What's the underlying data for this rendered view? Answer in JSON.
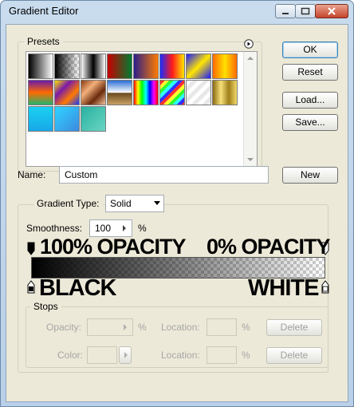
{
  "window": {
    "title": "Gradient Editor"
  },
  "presets": {
    "label": "Presets",
    "swatches": [
      {
        "name": "black-white",
        "bg": "linear-gradient(to right,#000,#fff)"
      },
      {
        "name": "foreground-transparent",
        "bg": "linear-gradient(to right,#000,rgba(0,0,0,0))",
        "checker": true
      },
      {
        "name": "black-to-white",
        "bg": "linear-gradient(to right,#fff 0%,#000 50%,#fff 100%)"
      },
      {
        "name": "red-green",
        "bg": "linear-gradient(to right,#c80000,#007a30)"
      },
      {
        "name": "violet-orange",
        "bg": "linear-gradient(to right,#2a1e8a,#ff7a00)"
      },
      {
        "name": "blue-red-yellow",
        "bg": "linear-gradient(to right,#1a2cff,#ff1a1a,#ffe400)"
      },
      {
        "name": "blue-yellow-blue",
        "bg": "linear-gradient(135deg,#1a1aff,#ffe600,#1a1aff)"
      },
      {
        "name": "orange-yellow-orange",
        "bg": "linear-gradient(to right,#ff6a00,#ffe000,#ff6a00)"
      },
      {
        "name": "violet-green-orange",
        "bg": "linear-gradient(to bottom,#6a1aa8,#ff6a00,#22b36b)"
      },
      {
        "name": "yellow-violet-orange-blue",
        "bg": "linear-gradient(135deg,#ffe400,#7a1aa8,#ff7a00,#1a3aff)"
      },
      {
        "name": "copper",
        "bg": "linear-gradient(135deg,#8a3a12,#f3b07a,#6a2a0c,#f3c29a)"
      },
      {
        "name": "chrome",
        "bg": "linear-gradient(to bottom,#2a6fd6,#ffffff 50%,#6b4a1e 52%,#c8a064)"
      },
      {
        "name": "spectrum",
        "bg": "linear-gradient(to right,#ff0000,#ffff00,#00ff00,#00ffff,#0000ff,#ff00ff,#ff0000)"
      },
      {
        "name": "transparent-rainbow",
        "bg": "repeating-linear-gradient(135deg,#ff3030 0 4px,#ffff30 4px 8px,#30ff30 8px 12px,#30ffff 12px 16px,#3030ff 16px 20px)"
      },
      {
        "name": "transparent-stripes",
        "bg": "repeating-linear-gradient(135deg,#ffffff 0 5px,#e8e8e8 5px 10px)",
        "checker": true
      },
      {
        "name": "gold",
        "bg": "linear-gradient(to right,#8a6a10,#f7e07a,#a07e1a,#f2da6a)"
      },
      {
        "name": "cyan",
        "bg": "linear-gradient(to bottom,#1ad0f0,#18a8e8)"
      },
      {
        "name": "cyan-blue",
        "bg": "linear-gradient(135deg,#2fd4ff,#3c8ae0)"
      },
      {
        "name": "teal",
        "bg": "linear-gradient(135deg,#2ab0a0,#6ad6c4)"
      }
    ]
  },
  "buttons": {
    "ok": "OK",
    "reset": "Reset",
    "load": "Load...",
    "save": "Save...",
    "new": "New"
  },
  "name_field": {
    "label": "Name:",
    "value": "Custom"
  },
  "gradient": {
    "type_label": "Gradient Type:",
    "type_value": "Solid",
    "smoothness_label": "Smoothness:",
    "smoothness_value": "100",
    "smoothness_unit": "%",
    "left_opacity_label": "100% OPACITY",
    "right_opacity_label": "0% OPACITY",
    "left_color_label": "BLACK",
    "right_color_label": "WHITE"
  },
  "stops": {
    "label": "Stops",
    "opacity_label": "Opacity:",
    "color_label": "Color:",
    "location_label": "Location:",
    "percent": "%",
    "delete": "Delete"
  },
  "colors": {
    "accent": "#3c7fb1",
    "panel": "#ece9d8"
  }
}
